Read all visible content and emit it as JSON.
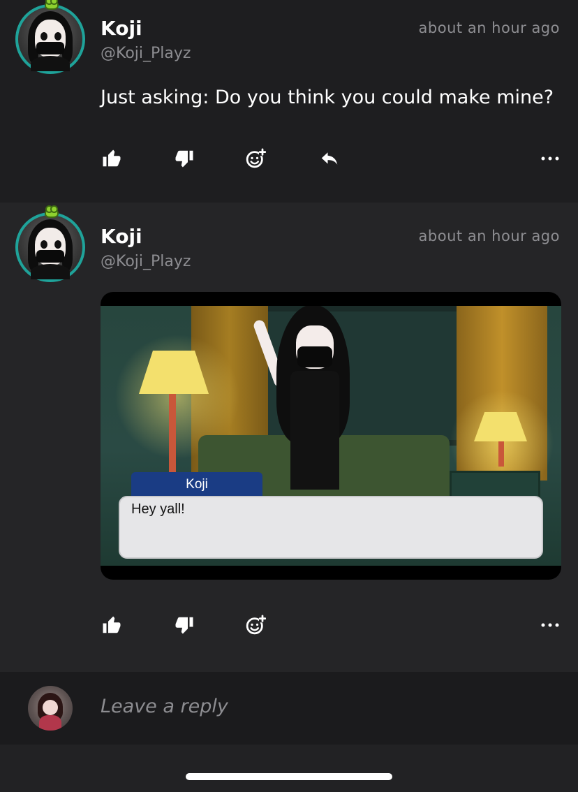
{
  "posts": [
    {
      "name": "Koji",
      "handle": "@Koji_Playz",
      "time": "about an hour ago",
      "text": "Just asking: Do you think you could make mine?",
      "actions": [
        "thumbs-up",
        "thumbs-down",
        "add-reaction",
        "reply",
        "more"
      ]
    },
    {
      "name": "Koji",
      "handle": "@Koji_Playz",
      "time": "about an hour ago",
      "image": {
        "speaker": "Koji",
        "dialogue": "Hey yall!"
      },
      "actions": [
        "thumbs-up",
        "thumbs-down",
        "add-reaction",
        "more"
      ]
    }
  ],
  "reply": {
    "placeholder": "Leave a reply"
  },
  "colors": {
    "background": "#1e1e20",
    "secondary_text": "#8d8d91",
    "avatar_ring": "#1fa39a"
  }
}
